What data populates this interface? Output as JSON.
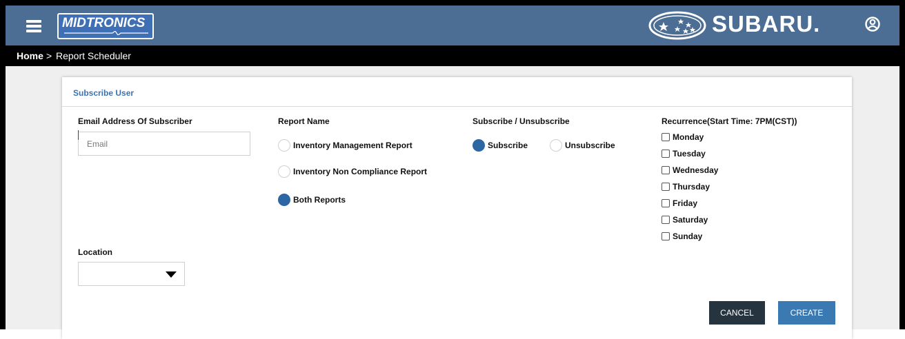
{
  "header": {
    "brand_logo_text": "MIDTRONICS",
    "partner_logo_text": "SUBARU.",
    "colors": {
      "bar": "#4c6d94",
      "accent": "#3a73b5",
      "cancel": "#263440",
      "create": "#3b79b2"
    }
  },
  "breadcrumb": {
    "home": "Home",
    "separator": ">",
    "current": "Report Scheduler"
  },
  "card": {
    "title": "Subscribe User"
  },
  "email": {
    "label": "Email Address Of Subscriber",
    "placeholder": "Email",
    "value": ""
  },
  "report": {
    "label": "Report Name",
    "options": [
      {
        "label": "Inventory Management Report",
        "selected": false
      },
      {
        "label": "Inventory Non Compliance Report",
        "selected": false
      },
      {
        "label": "Both Reports",
        "selected": true
      }
    ]
  },
  "subscription": {
    "label": "Subscribe / Unsubscribe",
    "options": [
      {
        "label": "Subscribe",
        "selected": true
      },
      {
        "label": "Unsubscribe",
        "selected": false
      }
    ]
  },
  "recurrence": {
    "label": "Recurrence(Start Time: 7PM(CST))",
    "days": [
      "Monday",
      "Tuesday",
      "Wednesday",
      "Thursday",
      "Friday",
      "Saturday",
      "Sunday"
    ]
  },
  "location": {
    "label": "Location",
    "selected": ""
  },
  "buttons": {
    "cancel": "CANCEL",
    "create": "CREATE"
  },
  "icons": [
    "hamburger-menu-icon",
    "user-account-icon",
    "subaru-star-emblem-icon",
    "dropdown-arrow-icon"
  ]
}
